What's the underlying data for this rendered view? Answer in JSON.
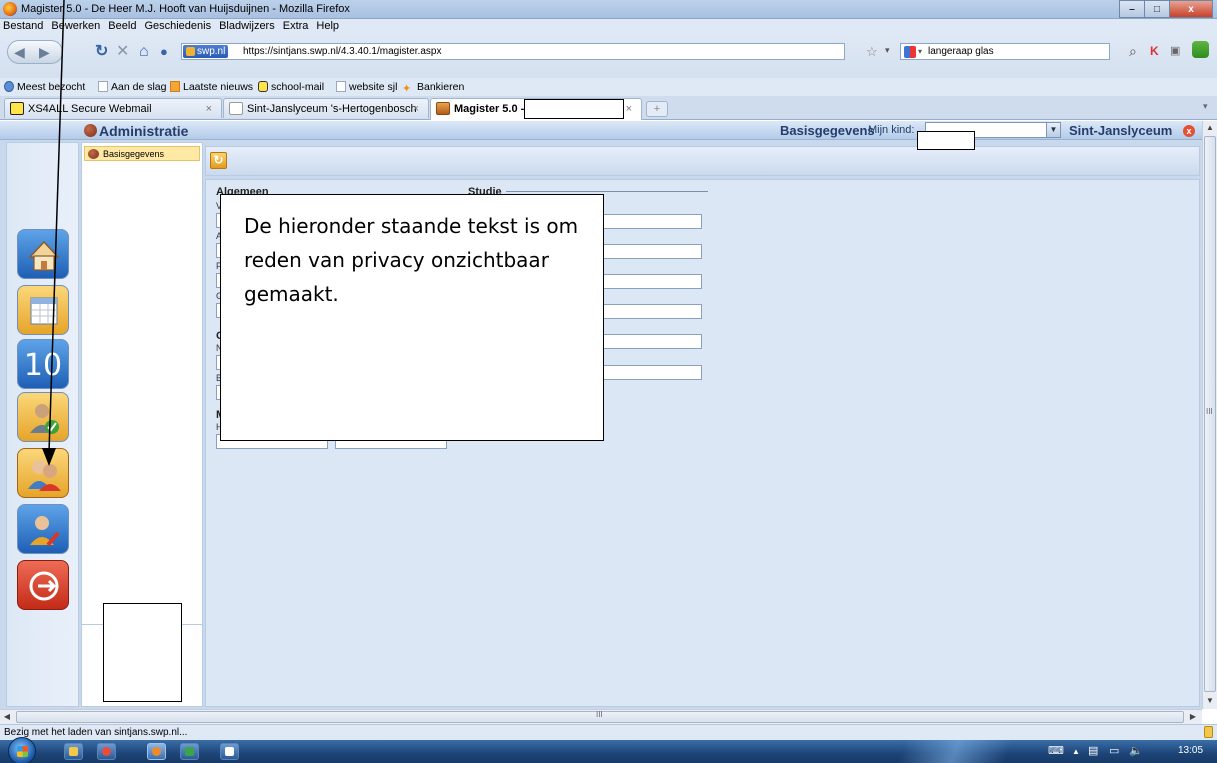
{
  "window": {
    "title": "Magister 5.0 - De Heer M.J. Hooft van Huijsduijnen - Mozilla Firefox",
    "controls": [
      "–",
      "□",
      "x"
    ]
  },
  "menu": [
    "Bestand",
    "Bewerken",
    "Beeld",
    "Geschiedenis",
    "Bladwijzers",
    "Extra",
    "Help"
  ],
  "navbar": {
    "site_badge": "swp.nl",
    "url": "https://sintjans.swp.nl/4.3.40.1/magister.aspx",
    "search_value": "langeraap glas"
  },
  "bookmarks": [
    "Meest bezocht",
    "Aan de slag",
    "Laatste nieuws",
    "school-mail",
    "website sjl",
    "Bankieren"
  ],
  "tabs": [
    {
      "label": "XS4ALL Secure Webmail",
      "close": "×"
    },
    {
      "label": "Sint-Janslyceum 's-Hertogenbosch",
      "close": "×"
    },
    {
      "label": "Magister 5.0 - I",
      "close": "×"
    }
  ],
  "tab_new": "+",
  "app": {
    "header_title": "Administratie",
    "basisgegevens": "Basisgegevens",
    "mijn_kind": "Mijn kind:",
    "school": "Sint-Janslyceum",
    "school_icon": "x",
    "subnav_item": "Basisgegevens",
    "refresh_symbol": "↻",
    "rail_number": "10",
    "sections": {
      "left": "Algemeen",
      "right": "Studie",
      "left_initials": [
        "V",
        "A",
        "F",
        "G"
      ],
      "left_second": "O",
      "left_second_initials": [
        "N",
        "B"
      ],
      "left_third": "M",
      "left_third_initials": [
        "H"
      ]
    }
  },
  "overlay_text": "De hieronder staande tekst is om reden van privacy onzichtbaar gemaakt.",
  "status": "Bezig met het laden van sintjans.swp.nl...",
  "scroll_grip": "III",
  "scroll_grip_h": "III",
  "clock": "13:05",
  "colors": {
    "header_text": "#243d6a",
    "subnav_selected": "#ffe9a4",
    "content_bg": "#dce7f5"
  }
}
